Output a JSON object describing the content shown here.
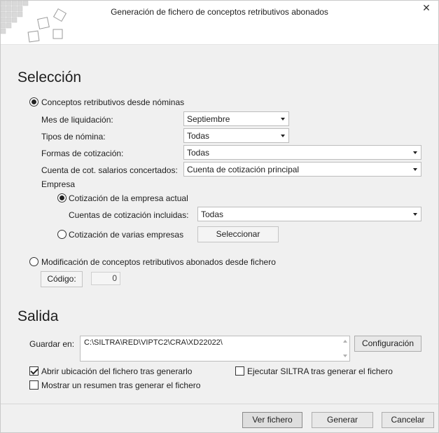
{
  "window": {
    "title": "Generación de fichero de conceptos retributivos abonados",
    "close_icon": "close-icon"
  },
  "seleccion": {
    "heading": "Selección",
    "opt_nominas": {
      "label": "Conceptos retributivos desde nóminas",
      "selected": true
    },
    "mes": {
      "label": "Mes de liquidación:",
      "value": "Septiembre"
    },
    "tipos": {
      "label": "Tipos de nómina:",
      "value": "Todas"
    },
    "formas": {
      "label": "Formas de cotización:",
      "value": "Todas"
    },
    "cuenta": {
      "label": "Cuenta de cot. salarios concertados:",
      "value": "Cuenta de cotización principal"
    },
    "empresa": {
      "label": "Empresa",
      "opt_actual": {
        "label": "Cotización de la empresa actual",
        "selected": true
      },
      "cuentas": {
        "label": "Cuentas de cotización incluidas:",
        "value": "Todas"
      },
      "opt_varias": {
        "label": "Cotización de varias empresas",
        "selected": false
      },
      "seleccionar_label": "Seleccionar"
    },
    "opt_fichero": {
      "label": "Modificación de conceptos retributivos abonados desde fichero",
      "selected": false
    },
    "codigo": {
      "label": "Código:",
      "value": "0"
    }
  },
  "salida": {
    "heading": "Salida",
    "guardar_label": "Guardar en:",
    "path": "C:\\SILTRA\\RED\\VIPTC2\\CRA\\XD22022\\",
    "config_label": "Configuración",
    "chk_abrir": {
      "label": "Abrir ubicación del fichero tras generarlo",
      "checked": true
    },
    "chk_ejecutar": {
      "label": "Ejecutar SILTRA tras generar el fichero",
      "checked": false
    },
    "chk_resumen": {
      "label": "Mostrar un resumen tras generar el fichero",
      "checked": false
    }
  },
  "footer": {
    "ver_label": "Ver fichero",
    "generar_label": "Generar",
    "cancelar_label": "Cancelar"
  }
}
